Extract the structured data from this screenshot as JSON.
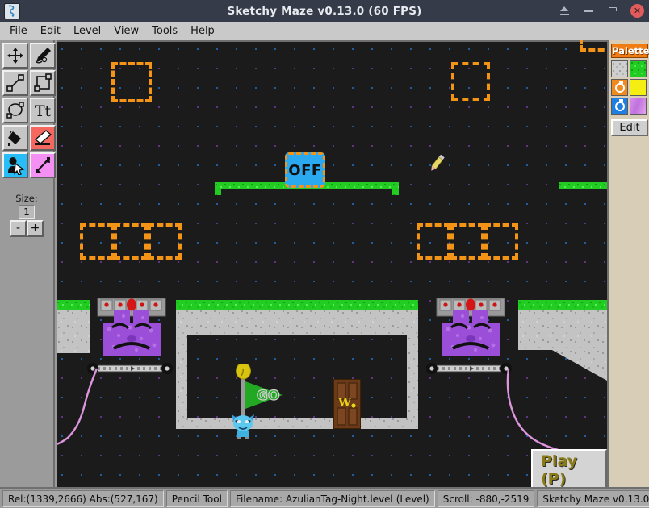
{
  "window": {
    "title": "Sketchy Maze v0.13.0 (60 FPS)",
    "logo_icon": "sketchy-maze-logo-icon",
    "controls": [
      {
        "name": "eject-button",
        "icon": "eject-icon"
      },
      {
        "name": "minimize-button",
        "icon": "minimize-icon"
      },
      {
        "name": "maximize-button",
        "icon": "maximize-icon"
      },
      {
        "name": "close-button",
        "icon": "close-icon",
        "label": "✕"
      }
    ]
  },
  "menubar": {
    "items": [
      {
        "label": "File"
      },
      {
        "label": "Edit"
      },
      {
        "label": "Level"
      },
      {
        "label": "View"
      },
      {
        "label": "Tools"
      },
      {
        "label": "Help"
      }
    ]
  },
  "toolbar": {
    "tools": [
      {
        "name": "pan-tool",
        "icon": "move-arrows-icon",
        "selected": false
      },
      {
        "name": "pencil-tool",
        "icon": "pencil-icon",
        "selected": false
      },
      {
        "name": "line-tool",
        "icon": "line-icon",
        "selected": false
      },
      {
        "name": "rectangle-tool",
        "icon": "rectangle-icon",
        "selected": false
      },
      {
        "name": "ellipse-tool",
        "icon": "ellipse-icon",
        "selected": false
      },
      {
        "name": "text-tool",
        "icon": "text-tt-icon",
        "selected": false
      },
      {
        "name": "fill-tool",
        "icon": "paint-bucket-icon",
        "selected": false
      },
      {
        "name": "eraser-tool",
        "icon": "eraser-icon",
        "selected": true
      },
      {
        "name": "doodad-tool",
        "icon": "actor-cursor-icon",
        "selected": true
      },
      {
        "name": "link-tool",
        "icon": "link-arrow-icon",
        "selected": true
      }
    ],
    "size_label": "Size:",
    "size_value": "1",
    "size_minus": "-",
    "size_plus": "+"
  },
  "palette": {
    "title": "Palette",
    "swatches": [
      {
        "name": "swatch-stone",
        "kind": "stone",
        "ring": false
      },
      {
        "name": "swatch-grass",
        "kind": "grass",
        "ring": false
      },
      {
        "name": "swatch-fire",
        "kind": "orange",
        "ring": true
      },
      {
        "name": "swatch-solid-yellow",
        "kind": "yellow",
        "ring": false
      },
      {
        "name": "swatch-water",
        "kind": "blue",
        "ring": true
      },
      {
        "name": "swatch-decoration",
        "kind": "purple",
        "ring": false
      }
    ],
    "edit_label": "Edit"
  },
  "canvas": {
    "play_button_label": "Play (P)",
    "doodads": [
      {
        "name": "off-button-doodad",
        "label": "OFF"
      }
    ],
    "characters": [
      {
        "name": "azulian-player",
        "kind": "blue-azulian"
      },
      {
        "name": "sleeping-azulian-left",
        "kind": "purple-sleeping-azulian"
      },
      {
        "name": "sleeping-azulian-right",
        "kind": "purple-sleeping-azulian"
      }
    ],
    "flag_label": "GO",
    "door_label": "W"
  },
  "statusbar": {
    "cells": [
      {
        "name": "cursor-coordinates",
        "text": "Rel:(1339,2666)  Abs:(527,167)"
      },
      {
        "name": "active-tool",
        "text": "Pencil Tool"
      },
      {
        "name": "filename",
        "text": "Filename: AzulianTag-Night.level (Level)"
      },
      {
        "name": "scroll-position",
        "text": "Scroll: -880,-2519"
      },
      {
        "name": "app-version",
        "text": "Sketchy Maze v0.13.0"
      }
    ]
  }
}
